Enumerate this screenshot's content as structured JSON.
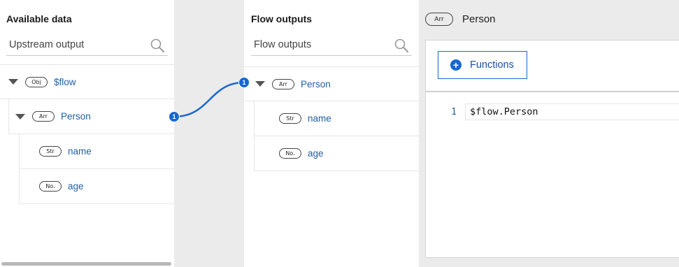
{
  "available": {
    "title": "Available data",
    "search_placeholder": "Upstream output",
    "tree": [
      {
        "badge": "Obj",
        "label": "$flow"
      },
      {
        "badge": "Arr",
        "label": "Person"
      },
      {
        "badge": "Str",
        "label": "name"
      },
      {
        "badge": "No.",
        "label": "age"
      }
    ]
  },
  "outputs": {
    "title": "Flow outputs",
    "search_placeholder": "Flow outputs",
    "tree": [
      {
        "badge": "Arr",
        "label": "Person"
      },
      {
        "badge": "Str",
        "label": "name"
      },
      {
        "badge": "No.",
        "label": "age"
      }
    ]
  },
  "mapping": {
    "link_count": "1",
    "source_count": "1"
  },
  "editor": {
    "header_badge": "Arr",
    "header_title": "Person",
    "functions_label": "Functions",
    "lines": [
      {
        "number": "1",
        "code": "$flow.Person"
      }
    ]
  },
  "colors": {
    "accent": "#1668d1",
    "link_text": "#1f5fa8"
  }
}
